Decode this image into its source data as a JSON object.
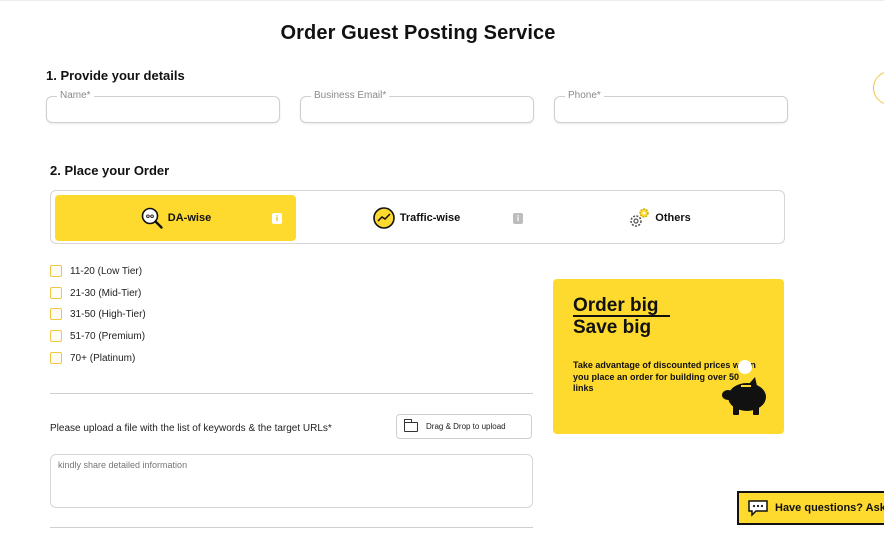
{
  "page": {
    "title": "Order Guest Posting Service"
  },
  "section1": {
    "title": "1. Provide your details",
    "fields": [
      {
        "label": "Name*",
        "value": ""
      },
      {
        "label": "Business Email*",
        "value": ""
      },
      {
        "label": "Phone*",
        "value": ""
      }
    ]
  },
  "section2": {
    "title": "2. Place your Order",
    "tabs": [
      {
        "label": "DA-wise",
        "icon": "da-magnifier-icon",
        "active": true,
        "info": "i"
      },
      {
        "label": "Traffic-wise",
        "icon": "traffic-chart-icon",
        "active": false,
        "info": "i"
      },
      {
        "label": "Others",
        "icon": "gears-icon",
        "active": false
      }
    ],
    "options": [
      {
        "label": "11-20 (Low Tier)",
        "checked": false
      },
      {
        "label": "21-30 (Mid-Tier)",
        "checked": false
      },
      {
        "label": "31-50 (High-Tier)",
        "checked": false
      },
      {
        "label": "51-70 (Premium)",
        "checked": false
      },
      {
        "label": "70+ (Platinum)",
        "checked": false
      }
    ],
    "upload": {
      "label": "Please upload a file with the list of keywords & the target URLs*",
      "button": "Drag & Drop to upload",
      "icon": "folder-icon"
    },
    "details": {
      "placeholder": "kindly share detailed information"
    }
  },
  "promo": {
    "title_line1": "Order big",
    "title_line2": "Save big",
    "text": "Take advantage of discounted prices when you place an order for building over 50 links",
    "icon": "piggy-bank-icon"
  },
  "chat": {
    "label": "Have questions? Ask",
    "icon": "chat-bubble-icon"
  },
  "colors": {
    "accent": "#fed92e",
    "checkbox_border": "#f0c646",
    "text": "#111111"
  }
}
